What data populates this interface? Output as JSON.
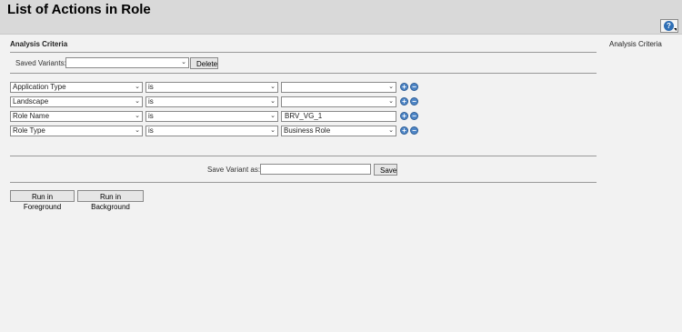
{
  "header": {
    "title": "List of Actions in Role",
    "help_icon": "?"
  },
  "section": {
    "title": "Analysis Criteria",
    "right_title": "Analysis Criteria"
  },
  "variants": {
    "label": "Saved Variants:",
    "selected": "",
    "delete_label": "Delete"
  },
  "criteria": [
    {
      "field": "Application Type",
      "operator": "is",
      "value": "",
      "value_type": "select"
    },
    {
      "field": "Landscape",
      "operator": "is",
      "value": "",
      "value_type": "select"
    },
    {
      "field": "Role Name",
      "operator": "is",
      "value": "BRV_VG_1",
      "value_type": "input"
    },
    {
      "field": "Role Type",
      "operator": "is",
      "value": "Business Role",
      "value_type": "select"
    }
  ],
  "icons": {
    "add": "+",
    "remove": "−",
    "chevron": "⌄"
  },
  "save_variant": {
    "label": "Save Variant as:",
    "value": "",
    "save_label": "Save"
  },
  "actions": {
    "foreground_label": "Run in Foreground",
    "background_label": "Run in Background"
  }
}
